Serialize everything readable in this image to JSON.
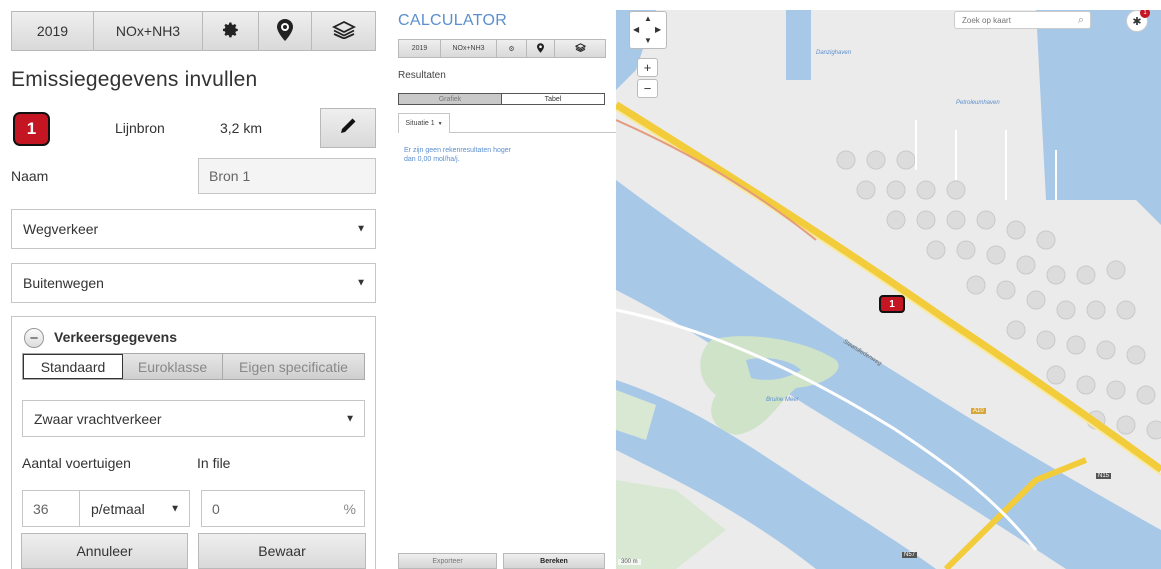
{
  "left": {
    "toolbar": {
      "year": "2019",
      "substance": "NOx+NH3",
      "icons": [
        "gear-icon",
        "map-marker-icon",
        "layers-icon"
      ]
    },
    "title": "Emissiegegevens invullen",
    "source": {
      "number": "1",
      "type": "Lijnbron",
      "length": "3,2 km"
    },
    "name": {
      "label": "Naam",
      "value": "Bron 1"
    },
    "sector": "Wegverkeer",
    "road_type": "Buitenwegen",
    "traffic": {
      "title": "Verkeersgegevens",
      "tabs": [
        "Standaard",
        "Euroklasse",
        "Eigen specificatie"
      ],
      "active_tab": "Standaard",
      "vehicle_type": "Zwaar vrachtverkeer",
      "count_label": "Aantal voertuigen",
      "jam_label": "In file",
      "count_value": "36",
      "unit": "p/etmaal",
      "jam_value": "0",
      "jam_unit": "%"
    },
    "buttons": {
      "cancel": "Annuleer",
      "save": "Bewaar"
    }
  },
  "mid": {
    "title": "CALCULATOR",
    "toolbar": {
      "year": "2019",
      "substance": "NOx+NH3"
    },
    "results_label": "Resultaten",
    "view_tabs": [
      "Grafiek",
      "Tabel"
    ],
    "situation_tab": "Situatie 1",
    "no_results": "Er zijn geen rekenresultaten hoger dan 0,00 mol/ha/j.",
    "buttons": {
      "export": "Exporteer",
      "calculate": "Bereken"
    }
  },
  "map": {
    "search_placeholder": "Zoek op kaart",
    "notification_count": "1",
    "marker_label": "1",
    "place_labels": [
      "Danzighaven",
      "Petroleumhaven",
      "Bruine Meer",
      "Staatsliedenweg",
      "A10",
      "N15",
      "N57"
    ],
    "scale_text": "300 m",
    "colors": {
      "water": "#a8c8e8",
      "land": "#ebebeb",
      "highway": "#f2cc3a",
      "road": "#ffffff",
      "marker": "#c31622"
    }
  }
}
